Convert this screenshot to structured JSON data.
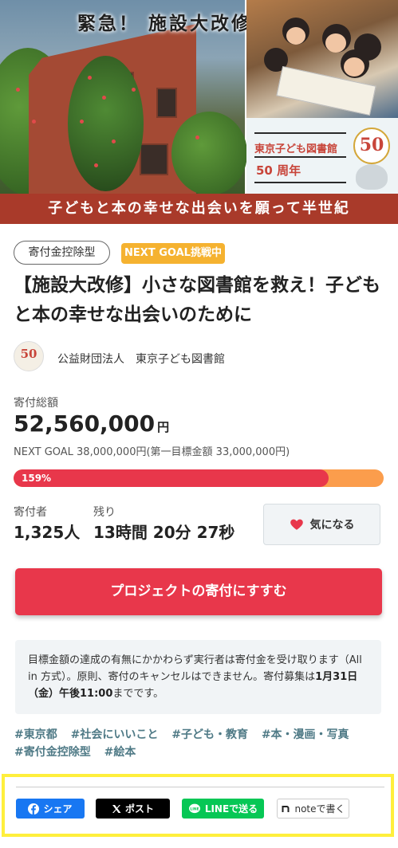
{
  "hero": {
    "headline": "緊急！ 施設大改修",
    "anniv_name": "東京子ども図書館",
    "anniv_year": "50 周年",
    "badge": "50",
    "banner": "子どもと本の幸せな出会いを願って半世紀"
  },
  "tags": {
    "deduction": "寄付金控除型",
    "next_goal": "NEXT GOAL挑戦中"
  },
  "title": "【施設大改修】小さな図書館を救え！子どもと本の幸せな出会いのために",
  "org": {
    "logo": "50",
    "name": "公益財団法人　東京子ども図書館"
  },
  "funding": {
    "total_label": "寄付総額",
    "total_amount": "52,560,000",
    "total_unit": "円",
    "next_goal": "NEXT GOAL 38,000,000円(第一目標金額 33,000,000円)",
    "progress_pct": 159,
    "progress_label": "159%",
    "donors_label": "寄付者",
    "donors_value": "1,325人",
    "remaining_label": "残り",
    "remaining_value": "13時間 20分 27秒"
  },
  "buttons": {
    "favorite": "気になる",
    "donate": "プロジェクトの寄付にすすむ"
  },
  "notice": {
    "line1": "目標金額の達成の有無にかかわらず実行者は寄付金を受け取ります（All in 方式）。原則、寄付のキャンセルはできません。寄付募集は",
    "deadline": "1月31日（金）午後11:00",
    "line2": "までです。"
  },
  "hashtags": [
    "#東京都",
    "#社会にいいこと",
    "#子ども・教育",
    "#本・漫画・写真",
    "#寄付金控除型",
    "#絵本"
  ],
  "share": {
    "facebook": "シェア",
    "x": "ポスト",
    "line": "LINEで送る",
    "note": "noteで書く"
  },
  "colors": {
    "accent": "#e8374b",
    "progress_bg": "#fb9d4c",
    "goal_badge": "#f5b230",
    "hashtag": "#4f7a86",
    "highlight": "#ffef3c"
  }
}
